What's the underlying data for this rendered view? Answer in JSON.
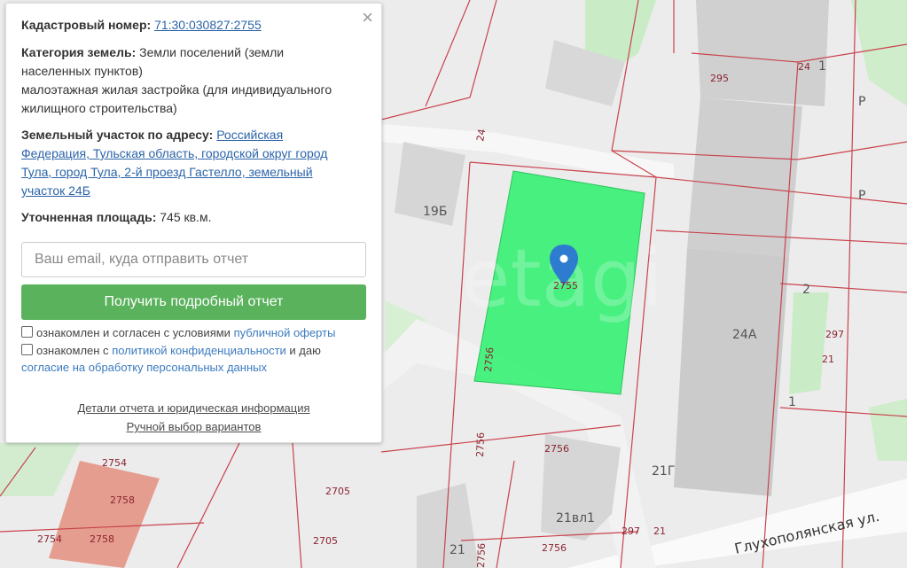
{
  "panel": {
    "close_icon": "×",
    "cadastral_label": "Кадастровый номер:",
    "cadastral_value": "71:30:030827:2755",
    "category_label": "Категория земель:",
    "category_value_1": "Земли поселений (земли",
    "category_value_2": "населенных пунктов)",
    "usage_1": "малоэтажная жилая застройка (для индивидуального",
    "usage_2": "жилищного строительства)",
    "address_label": "Земельный участок по адресу:",
    "address_1": "Российская",
    "address_2": "Федерация, Тульская область, городской округ город",
    "address_3": "Тула, город Тула, 2-й проезд Гастелло, земельный",
    "address_4": "участок 24Б",
    "area_label": "Уточненная площадь:",
    "area_value": "745 кв.м.",
    "email_placeholder": "Ваш email, куда отправить отчет",
    "button_label": "Получить подробный отчет",
    "check1_text": "ознакомлен и согласен с условиями",
    "check1_link": "публичной оферты",
    "check2_text": "ознакомлен с",
    "check2_link1": "политикой конфиденциальности",
    "check2_mid": "и даю",
    "check2_link2": "согласие на обработку персональных данных",
    "details_link": "Детали отчета и юридическая информация",
    "manual_link": "Ручной выбор вариантов"
  },
  "map": {
    "parcel_color": "#3ff07a",
    "parcel_label": "2755",
    "street": "Глухополянская ул.",
    "watermark": "etagi",
    "labels": {
      "l295": "295",
      "l241": "24",
      "l1a": "1",
      "lP1": "P",
      "lP2": "P",
      "l24": "24",
      "l19b": "19Б",
      "l24a": "24А",
      "l2": "2",
      "l297a": "297",
      "l21a": "21",
      "l1b": "1",
      "l2756a": "2756",
      "l2756b": "2756",
      "l2756c": "2756",
      "l2756d": "2756",
      "l2756e": "2756",
      "l21g": "21Г",
      "l21vl1": "21вл1",
      "l297b": "297",
      "l21b": "21",
      "l2705a": "2705",
      "l2705b": "2705",
      "l2754a": "2754",
      "l2754b": "2754",
      "l2758a": "2758",
      "l2758b": "2758",
      "l21c": "21"
    }
  }
}
